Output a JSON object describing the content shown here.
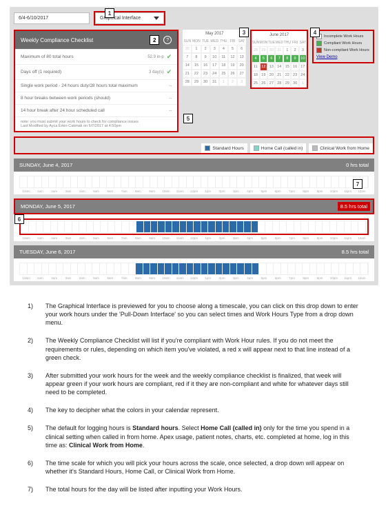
{
  "header": {
    "date_range": "6/4-6/10/2017",
    "interface_select": "Graphical Interface"
  },
  "callouts": {
    "c1": "1",
    "c2": "2",
    "c3": "3",
    "c4": "4",
    "c5": "5",
    "c6": "6",
    "c7": "7"
  },
  "checklist": {
    "title": "Weekly Compliance Checklist",
    "help": "?",
    "items": [
      {
        "label": "Maximum of 80 total hours",
        "value": "52.9 in-p",
        "status": "ok"
      },
      {
        "label": "Days off (1 required)",
        "value": "3 day(s)",
        "status": "ok"
      },
      {
        "label": "Single work period - 24 hours duty/28 hours total maximum",
        "value": "--",
        "status": "none"
      },
      {
        "label": "8 hour breaks between work periods (should)",
        "value": "--",
        "status": "none"
      },
      {
        "label": "14 hour break after 24 hour scheduled call",
        "value": "--",
        "status": "none"
      }
    ],
    "footer1": "note: you must submit your work hours to check for compliance issues",
    "footer2": "Last Modified by Ayca Erkin-Cakmak on 6/7/2017 at 4:50pm"
  },
  "calendars": {
    "may": {
      "title": "May 2017",
      "dow": [
        "SUN",
        "MON",
        "TUE",
        "WED",
        "THU",
        "FRI",
        "SAT"
      ]
    },
    "june": {
      "title": "June 2017",
      "dow": [
        "SUN",
        "MON",
        "TUE",
        "WED",
        "THU",
        "FRI",
        "SAT"
      ]
    }
  },
  "legend_side": {
    "incomplete": "Incomplete Work Hours",
    "compliant": "Compliant Work Hours",
    "noncompliant": "Non-compliant Work Hours",
    "link": "View Demo"
  },
  "legend_bar": {
    "standard": "Standard Hours",
    "homecall": "Home Call (called in)",
    "clinical": "Clinical Work from Home"
  },
  "days": {
    "sun": {
      "head": "SUNDAY, June 4, 2017",
      "total": "0 hrs total"
    },
    "mon": {
      "head": "MONDAY, June 5, 2017",
      "total": "8.5 hrs total"
    },
    "tue": {
      "head": "TUESDAY, June 6, 2017",
      "total": "8.5 hrs total"
    }
  },
  "timeline_labels": [
    "12am",
    "1am",
    "2am",
    "3am",
    "4am",
    "5am",
    "6am",
    "7am",
    "8am",
    "9am",
    "10am",
    "11am",
    "12pm",
    "1pm",
    "2pm",
    "3pm",
    "4pm",
    "5pm",
    "6pm",
    "7pm",
    "8pm",
    "9pm",
    "10pm",
    "11pm",
    "12am"
  ],
  "notes": {
    "n1": {
      "num": "1)",
      "text": "The Graphical Interface is previewed for you to choose along a timescale, you can click on this drop down to enter your work hours under the 'Pull-Down Interface' so you can select times and Work Hours Type from a drop down menu."
    },
    "n2": {
      "num": "2)",
      "text": "The Weekly Compliance Checklist will list if you're compliant with Work Hour rules.   If you do not meet the requirements or rules, depending on which item you've violated, a red x will appear next to that line instead of a green check."
    },
    "n3": {
      "num": "3)",
      "text": "After submitted your work hours for the week and the weekly compliance checklist is finalized, that week will appear green if your work hours are compliant, red if it they are non-compliant and white for whatever days still need to be completed."
    },
    "n4": {
      "num": "4)",
      "text": "The key to decipher what the colors in your calendar represent."
    },
    "n5": {
      "num": "5)",
      "text_pre": "The default for logging hours is ",
      "b1": "Standard hours",
      "text_mid": ". Select ",
      "b2": "Home Call (called in)",
      "text_mid2": " only for the time you spend in a clinical setting when called in from home.  Apex usage, patient notes, charts, etc. completed at home, log in this time as: ",
      "b3": "Clinical Work from Home",
      "text_post": "."
    },
    "n6": {
      "num": "6)",
      "text": "The time scale for which you will pick your hours across the scale, once selected, a drop down will appear on whether it's Standard Hours, Home Call, or Clinical Work from Home."
    },
    "n7": {
      "num": "7)",
      "text": "The total hours for the day will be listed after inputting your Work Hours."
    }
  }
}
